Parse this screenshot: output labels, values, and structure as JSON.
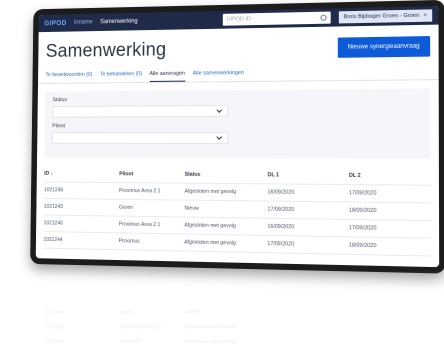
{
  "topbar": {
    "brand": "GIPOD",
    "nav_home": "Inname",
    "nav_current": "Samenwerking",
    "search_placeholder": "GIPOD ID",
    "user": "Boris Bijdrager Groen - Groen"
  },
  "header": {
    "title": "Samenwerking",
    "new_button": "Nieuwe synergieaanvraag"
  },
  "tabs": [
    {
      "label": "Te beantwoorden (0)"
    },
    {
      "label": "Te behandelen (0)"
    },
    {
      "label": "Alle aanvragen"
    },
    {
      "label": "Alle samenwerkingen"
    }
  ],
  "filters": {
    "status_label": "Status",
    "pilot_label": "Piloot"
  },
  "table": {
    "headers": [
      "ID ↓",
      "Piloot",
      "Status",
      "DL 1",
      "DL 2"
    ],
    "rows": [
      [
        "1021248",
        "Proximus Area 2.1",
        "Afgesloten met gevolg",
        "16/09/2020",
        "17/09/2020"
      ],
      [
        "1021243",
        "Groen",
        "Nieuw",
        "17/09/2020",
        "18/09/2020"
      ],
      [
        "1021240",
        "Proximus Area 2.1",
        "Afgesloten met gevolg",
        "16/09/2020",
        "17/09/2020"
      ],
      [
        "1021244",
        "Proximus",
        "Afgesloten met gevolg",
        "17/09/2020",
        "18/09/2020"
      ]
    ]
  },
  "colors": {
    "topbar": "#1f2b49",
    "primary": "#0d5bd8",
    "tab_link": "#2d69c9"
  }
}
